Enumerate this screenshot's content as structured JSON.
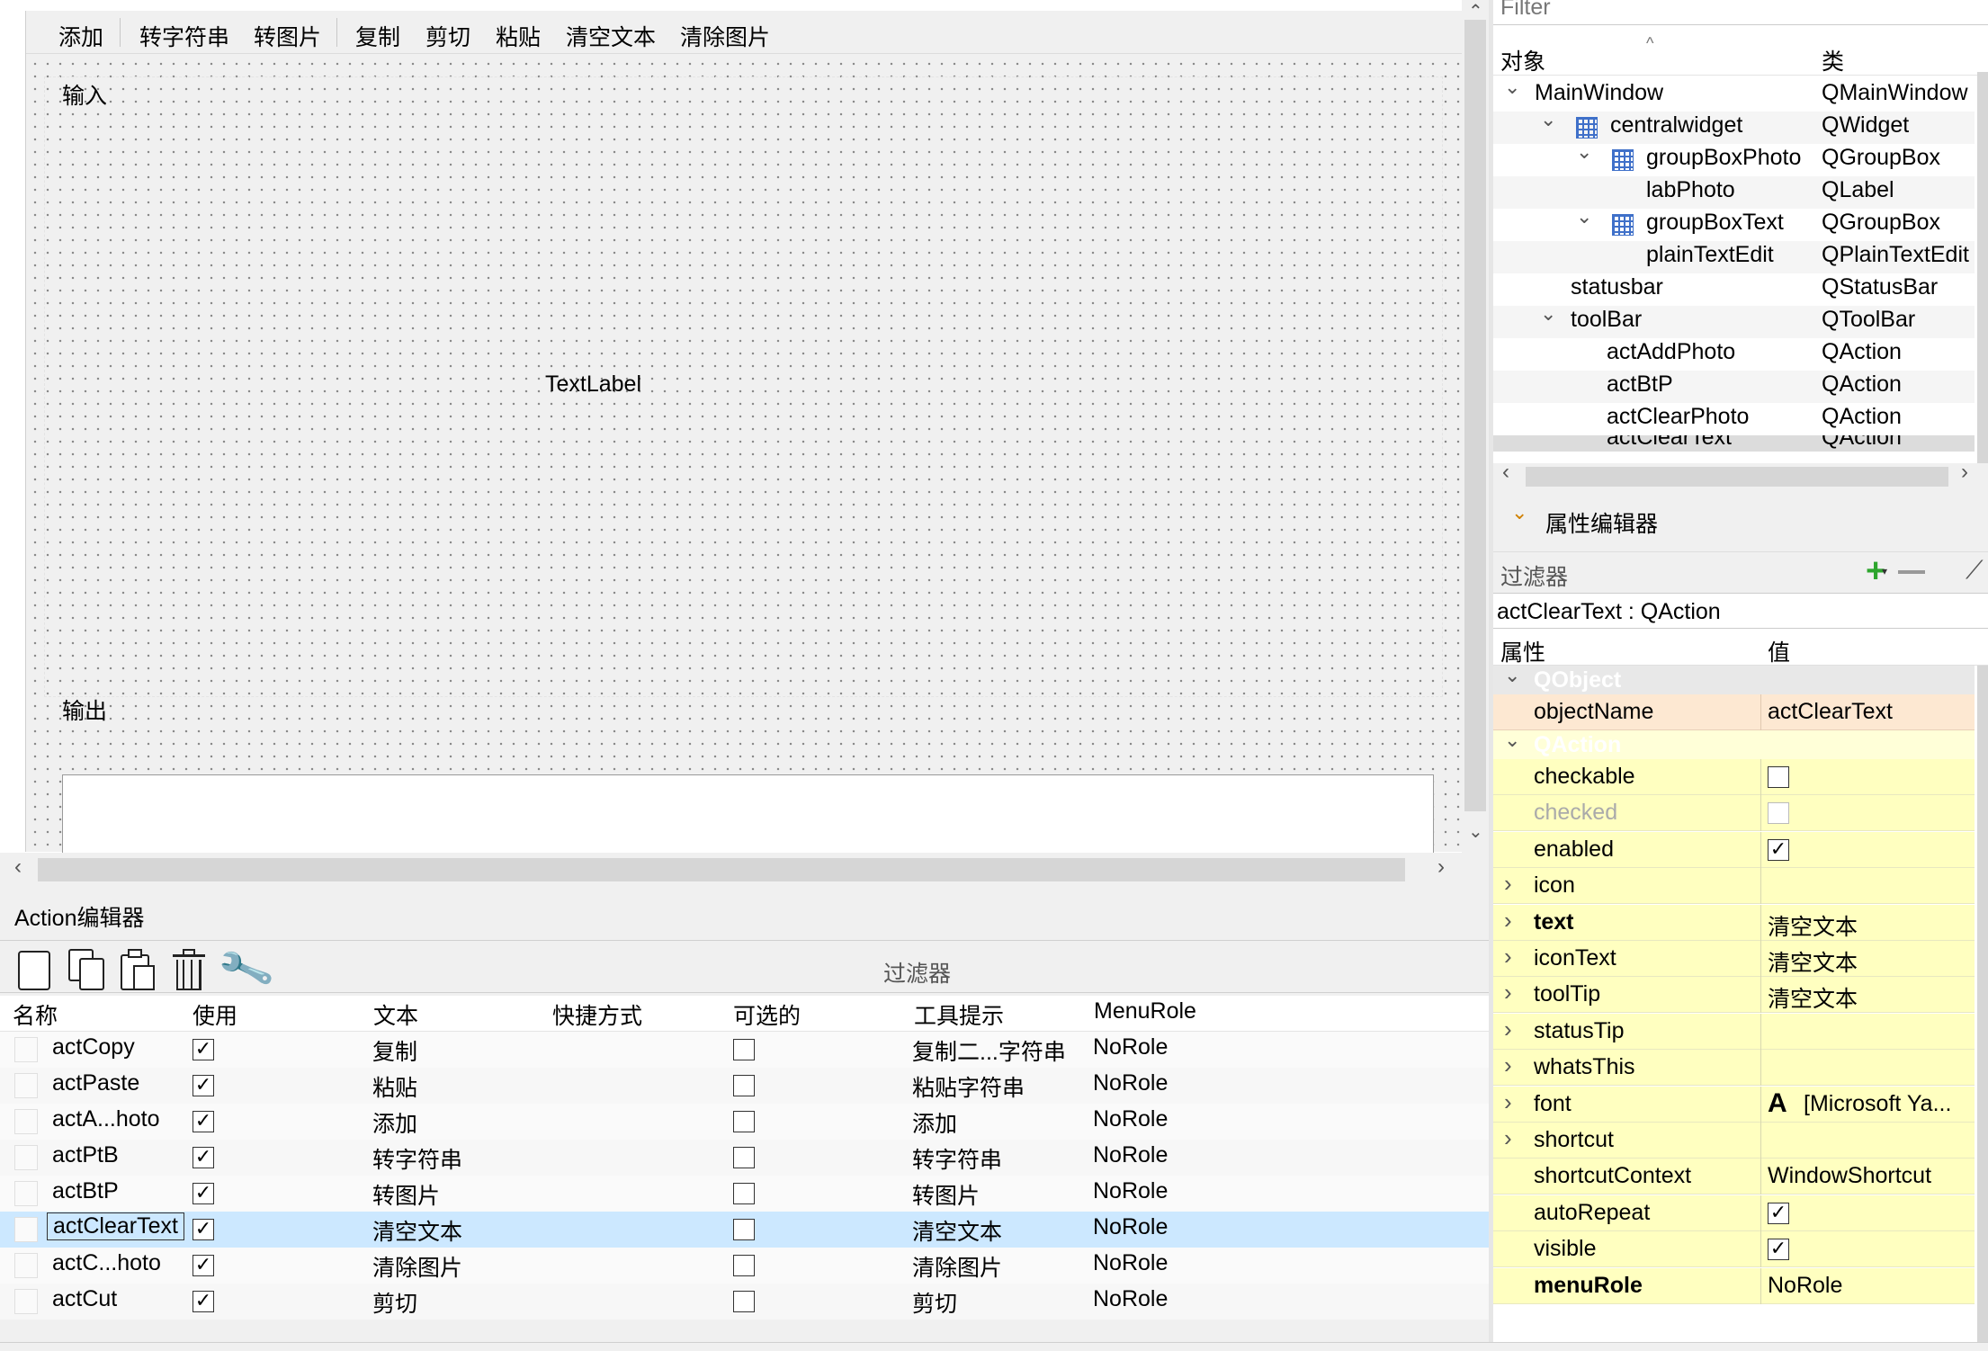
{
  "form": {
    "toolbar": [
      "添加",
      "转字符串",
      "转图片",
      "复制",
      "剪切",
      "粘贴",
      "清空文本",
      "清除图片"
    ],
    "group_input_title": "输入",
    "label_text": "TextLabel",
    "group_output_title": "输出"
  },
  "action_editor": {
    "title": "Action编辑器",
    "filter_placeholder": "过滤器",
    "columns": [
      "名称",
      "使用",
      "文本",
      "快捷方式",
      "可选的",
      "工具提示",
      "MenuRole"
    ],
    "rows": [
      {
        "name": "actCopy",
        "used": true,
        "text": "复制",
        "shortcut": "",
        "checkable": false,
        "tooltip": "复制二...字符串",
        "role": "NoRole"
      },
      {
        "name": "actPaste",
        "used": true,
        "text": "粘贴",
        "shortcut": "",
        "checkable": false,
        "tooltip": "粘贴字符串",
        "role": "NoRole"
      },
      {
        "name": "actA...hoto",
        "used": true,
        "text": "添加",
        "shortcut": "",
        "checkable": false,
        "tooltip": "添加",
        "role": "NoRole"
      },
      {
        "name": "actPtB",
        "used": true,
        "text": "转字符串",
        "shortcut": "",
        "checkable": false,
        "tooltip": "转字符串",
        "role": "NoRole"
      },
      {
        "name": "actBtP",
        "used": true,
        "text": "转图片",
        "shortcut": "",
        "checkable": false,
        "tooltip": "转图片",
        "role": "NoRole"
      },
      {
        "name": "actClearText",
        "used": true,
        "text": "清空文本",
        "shortcut": "",
        "checkable": false,
        "tooltip": "清空文本",
        "role": "NoRole",
        "selected": true
      },
      {
        "name": "actC...hoto",
        "used": true,
        "text": "清除图片",
        "shortcut": "",
        "checkable": false,
        "tooltip": "清除图片",
        "role": "NoRole"
      },
      {
        "name": "actCut",
        "used": true,
        "text": "剪切",
        "shortcut": "",
        "checkable": false,
        "tooltip": "剪切",
        "role": "NoRole"
      }
    ]
  },
  "object_inspector": {
    "filter_placeholder": "Filter",
    "col_object": "对象",
    "col_class": "类",
    "items": [
      {
        "name": "MainWindow",
        "class": "QMainWindow",
        "level": 0,
        "expand": "v",
        "icon": false
      },
      {
        "name": "centralwidget",
        "class": "QWidget",
        "level": 1,
        "expand": "v",
        "icon": true
      },
      {
        "name": "groupBoxPhoto",
        "class": "QGroupBox",
        "level": 2,
        "expand": "v",
        "icon": true
      },
      {
        "name": "labPhoto",
        "class": "QLabel",
        "level": 3,
        "expand": "",
        "icon": false
      },
      {
        "name": "groupBoxText",
        "class": "QGroupBox",
        "level": 2,
        "expand": "v",
        "icon": true
      },
      {
        "name": "plainTextEdit",
        "class": "QPlainTextEdit",
        "level": 3,
        "expand": "",
        "icon": false
      },
      {
        "name": "statusbar",
        "class": "QStatusBar",
        "level": 1,
        "expand": "",
        "icon": false
      },
      {
        "name": "toolBar",
        "class": "QToolBar",
        "level": 1,
        "expand": "v",
        "icon": false
      },
      {
        "name": "actAddPhoto",
        "class": "QAction",
        "level": 2,
        "expand": "",
        "icon": false
      },
      {
        "name": "actBtP",
        "class": "QAction",
        "level": 2,
        "expand": "",
        "icon": false
      },
      {
        "name": "actClearPhoto",
        "class": "QAction",
        "level": 2,
        "expand": "",
        "icon": false
      },
      {
        "name": "actClearText",
        "class": "QAction",
        "level": 2,
        "expand": "",
        "icon": false
      }
    ]
  },
  "property_editor": {
    "title": "属性编辑器",
    "filter_placeholder": "过滤器",
    "object_label": "actClearText : QAction",
    "col_property": "属性",
    "col_value": "值",
    "section_qobject": "QObject",
    "section_qaction": "QAction",
    "object_name_key": "objectName",
    "object_name_value": "actClearText",
    "props": [
      {
        "key": "checkable",
        "value": "",
        "check": "off",
        "bold": false,
        "dim": false,
        "expand": false
      },
      {
        "key": "checked",
        "value": "",
        "check": "off",
        "bold": false,
        "dim": true,
        "expand": false
      },
      {
        "key": "enabled",
        "value": "",
        "check": "on",
        "bold": false,
        "dim": false,
        "expand": false
      },
      {
        "key": "icon",
        "value": "",
        "check": "",
        "bold": false,
        "dim": false,
        "expand": true
      },
      {
        "key": "text",
        "value": "清空文本",
        "check": "",
        "bold": true,
        "dim": false,
        "expand": true
      },
      {
        "key": "iconText",
        "value": "清空文本",
        "check": "",
        "bold": false,
        "dim": false,
        "expand": true
      },
      {
        "key": "toolTip",
        "value": "清空文本",
        "check": "",
        "bold": false,
        "dim": false,
        "expand": true
      },
      {
        "key": "statusTip",
        "value": "",
        "check": "",
        "bold": false,
        "dim": false,
        "expand": true
      },
      {
        "key": "whatsThis",
        "value": "",
        "check": "",
        "bold": false,
        "dim": false,
        "expand": true
      },
      {
        "key": "font",
        "value": "[Microsoft Ya...",
        "check": "",
        "bold": false,
        "dim": false,
        "expand": true,
        "font_glyph": "A"
      },
      {
        "key": "shortcut",
        "value": "",
        "check": "",
        "bold": false,
        "dim": false,
        "expand": true
      },
      {
        "key": "shortcutContext",
        "value": "WindowShortcut",
        "check": "",
        "bold": false,
        "dim": false,
        "expand": false
      },
      {
        "key": "autoRepeat",
        "value": "",
        "check": "on",
        "bold": false,
        "dim": false,
        "expand": false
      },
      {
        "key": "visible",
        "value": "",
        "check": "on",
        "bold": false,
        "dim": false,
        "expand": false
      },
      {
        "key": "menuRole",
        "value": "NoRole",
        "check": "",
        "bold": true,
        "dim": false,
        "expand": false
      }
    ]
  }
}
